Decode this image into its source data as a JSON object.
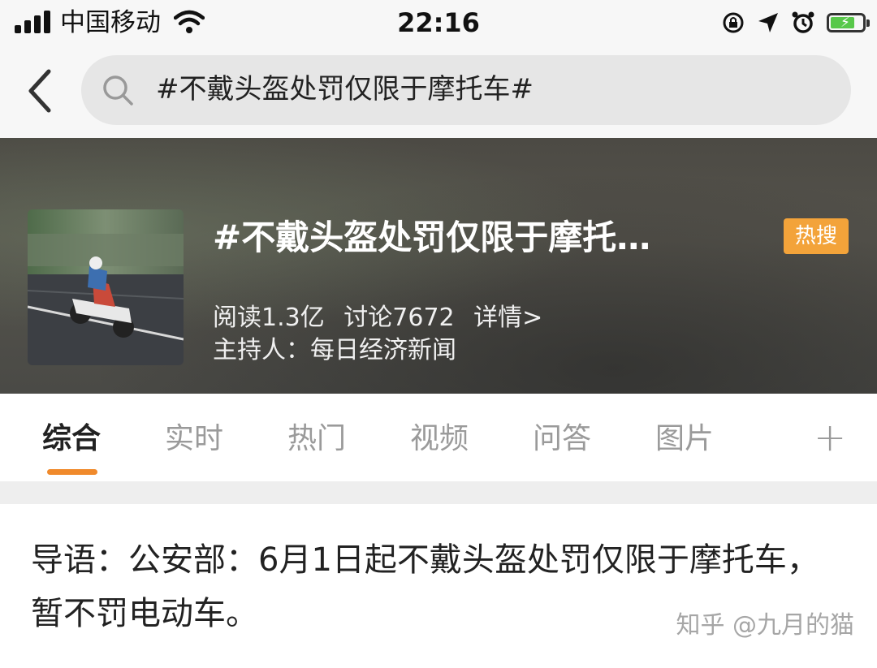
{
  "status_bar": {
    "carrier": "中国移动",
    "time": "22:16"
  },
  "search": {
    "query": "#不戴头盔处罚仅限于摩托车#"
  },
  "topic": {
    "title": "#不戴头盔处罚仅限于摩托…",
    "badge": "热搜",
    "reads": "阅读1.3亿",
    "discussions": "讨论7672",
    "details": "详情>",
    "host": "主持人：每日经济新闻"
  },
  "tabs": [
    {
      "label": "综合",
      "active": true
    },
    {
      "label": "实时"
    },
    {
      "label": "热门"
    },
    {
      "label": "视频"
    },
    {
      "label": "问答"
    },
    {
      "label": "图片"
    }
  ],
  "tab_add": "+",
  "intro": {
    "text": "导语：公安部：6月1日起不戴头盔处罚仅限于摩托车，暂不罚电动车。"
  },
  "watermark": "知乎 @九月的猫",
  "colors": {
    "accent": "#f08a2c",
    "badge": "#f3a33a",
    "battery": "#58c84a"
  }
}
